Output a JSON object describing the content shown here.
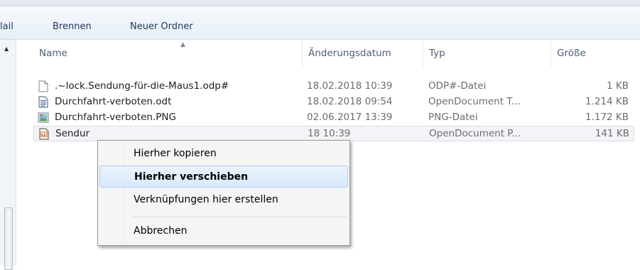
{
  "toolbar": {
    "items": [
      "lail",
      "Brennen",
      "Neuer Ordner"
    ]
  },
  "columns": [
    "Name",
    "Änderungsdatum",
    "Typ",
    "Größe"
  ],
  "files": [
    {
      "name": ".~lock.Sendung-für-die-Maus1.odp#",
      "date": "18.02.2018 10:39",
      "type": "ODP#-Datei",
      "size": "1 KB",
      "icon": "blank-file-icon"
    },
    {
      "name": "Durchfahrt-verboten.odt",
      "date": "18.02.2018 09:54",
      "type": "OpenDocument T...",
      "size": "1.214 KB",
      "icon": "odt-document-icon"
    },
    {
      "name": "Durchfahrt-verboten.PNG",
      "date": "02.06.2017 13:39",
      "type": "PNG-Datei",
      "size": "1.172 KB",
      "icon": "png-image-icon"
    },
    {
      "name": "Sendur",
      "date": "18 10:39",
      "type": "OpenDocument P...",
      "size": "141 KB",
      "icon": "odp-presentation-icon"
    }
  ],
  "context_menu": {
    "items": [
      "Hierher kopieren",
      "Hierher verschieben",
      "Verknüpfungen hier erstellen",
      "Abbrechen"
    ],
    "default_item": "Hierher verschieben"
  },
  "colors": {
    "toolbar_text": "#1e395b",
    "header_text": "#4c607a",
    "muted_text": "#6d6d6d",
    "menu_highlight": "#d9e9fb"
  }
}
